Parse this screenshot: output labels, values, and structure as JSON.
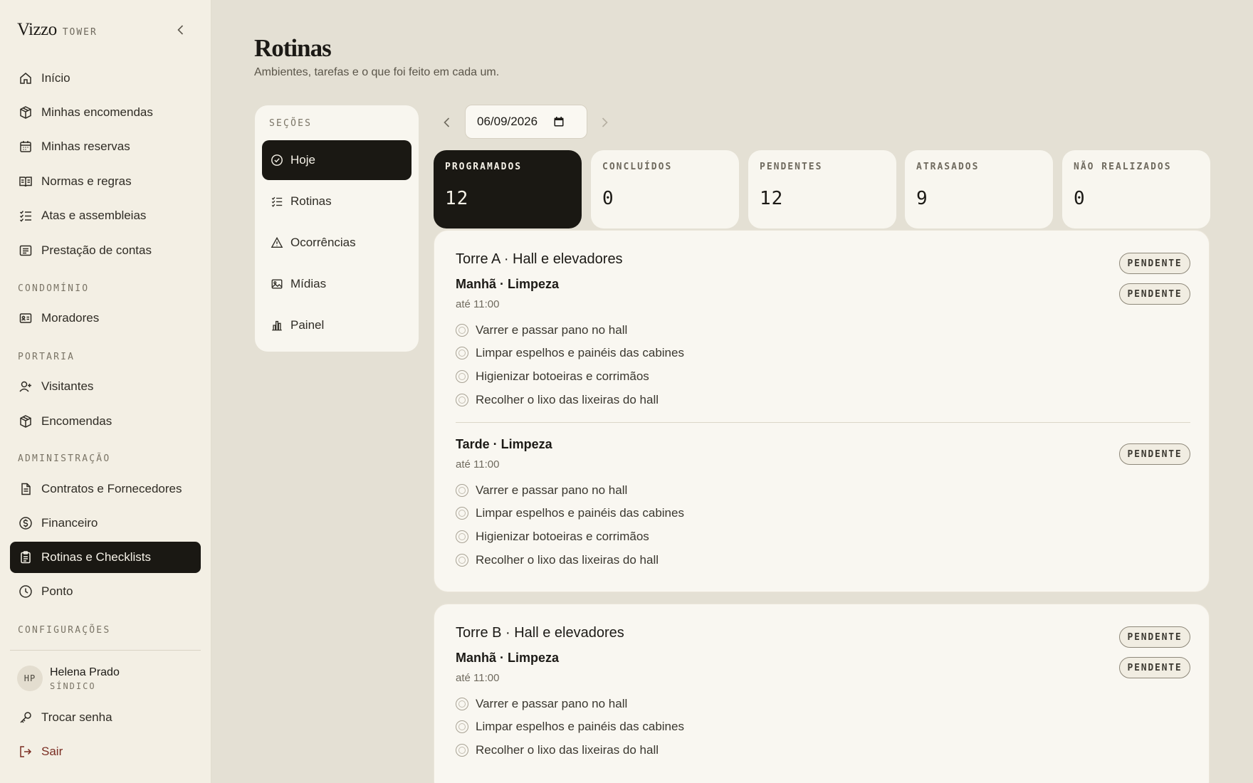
{
  "brand": {
    "name": "Vizzo",
    "sub": "TOWER"
  },
  "nav": {
    "top": [
      {
        "label": "Início",
        "icon": "home-icon"
      },
      {
        "label": "Minhas encomendas",
        "icon": "package-icon"
      },
      {
        "label": "Minhas reservas",
        "icon": "calendar-icon"
      },
      {
        "label": "Normas e regras",
        "icon": "book-icon"
      },
      {
        "label": "Atas e assembleias",
        "icon": "list-check-icon"
      },
      {
        "label": "Prestação de contas",
        "icon": "receipt-icon"
      }
    ],
    "condominio_label": "CONDOMÍNIO",
    "condominio": [
      {
        "label": "Moradores",
        "icon": "id-card-icon"
      }
    ],
    "portaria_label": "PORTARIA",
    "portaria": [
      {
        "label": "Visitantes",
        "icon": "user-plus-icon"
      },
      {
        "label": "Encomendas",
        "icon": "package-icon"
      }
    ],
    "admin_label": "ADMINISTRAÇÃO",
    "admin": [
      {
        "label": "Contratos e Fornecedores",
        "icon": "document-icon"
      },
      {
        "label": "Financeiro",
        "icon": "dollar-icon"
      },
      {
        "label": "Rotinas e Checklists",
        "icon": "clipboard-icon",
        "active": true
      },
      {
        "label": "Ponto",
        "icon": "clock-icon"
      }
    ],
    "config_label": "CONFIGURAÇÕES"
  },
  "user": {
    "initials": "HP",
    "name": "Helena Prado",
    "role": "SÍNDICO"
  },
  "account": {
    "change_password": "Trocar senha",
    "logout": "Sair"
  },
  "page": {
    "title": "Rotinas",
    "subtitle": "Ambientes, tarefas e o que foi feito em cada um."
  },
  "sections": {
    "label": "SEÇÕES",
    "items": [
      {
        "label": "Hoje",
        "icon": "check-circle-icon",
        "active": true
      },
      {
        "label": "Rotinas",
        "icon": "list-check-icon"
      },
      {
        "label": "Ocorrências",
        "icon": "warning-icon"
      },
      {
        "label": "Mídias",
        "icon": "image-icon"
      },
      {
        "label": "Painel",
        "icon": "bar-chart-icon"
      }
    ]
  },
  "date": {
    "value": "06/09/2026"
  },
  "stats": [
    {
      "label": "PROGRAMADOS",
      "value": "12",
      "active": true
    },
    {
      "label": "CONCLUÍDOS",
      "value": "0"
    },
    {
      "label": "PENDENTES",
      "value": "12"
    },
    {
      "label": "ATRASADOS",
      "value": "9"
    },
    {
      "label": "NÃO REALIZADOS",
      "value": "0"
    }
  ],
  "cards": [
    {
      "title": "Torre A · Hall e elevadores",
      "status": "PENDENTE",
      "shifts": [
        {
          "title": "Manhã · Limpeza",
          "time": "até 11:00",
          "status": "PENDENTE",
          "tasks": [
            "Varrer e passar pano no hall",
            "Limpar espelhos e painéis das cabines",
            "Higienizar botoeiras e corrimãos",
            "Recolher o lixo das lixeiras do hall"
          ]
        },
        {
          "title": "Tarde · Limpeza",
          "time": "até 11:00",
          "status": "PENDENTE",
          "tasks": [
            "Varrer e passar pano no hall",
            "Limpar espelhos e painéis das cabines",
            "Higienizar botoeiras e corrimãos",
            "Recolher o lixo das lixeiras do hall"
          ]
        }
      ]
    },
    {
      "title": "Torre B · Hall e elevadores",
      "status": "PENDENTE",
      "shifts": [
        {
          "title": "Manhã · Limpeza",
          "time": "até 11:00",
          "status": "PENDENTE",
          "tasks": [
            "Varrer e passar pano no hall",
            "Limpar espelhos e painéis das cabines",
            "Recolher o lixo das lixeiras do hall"
          ]
        }
      ]
    }
  ]
}
